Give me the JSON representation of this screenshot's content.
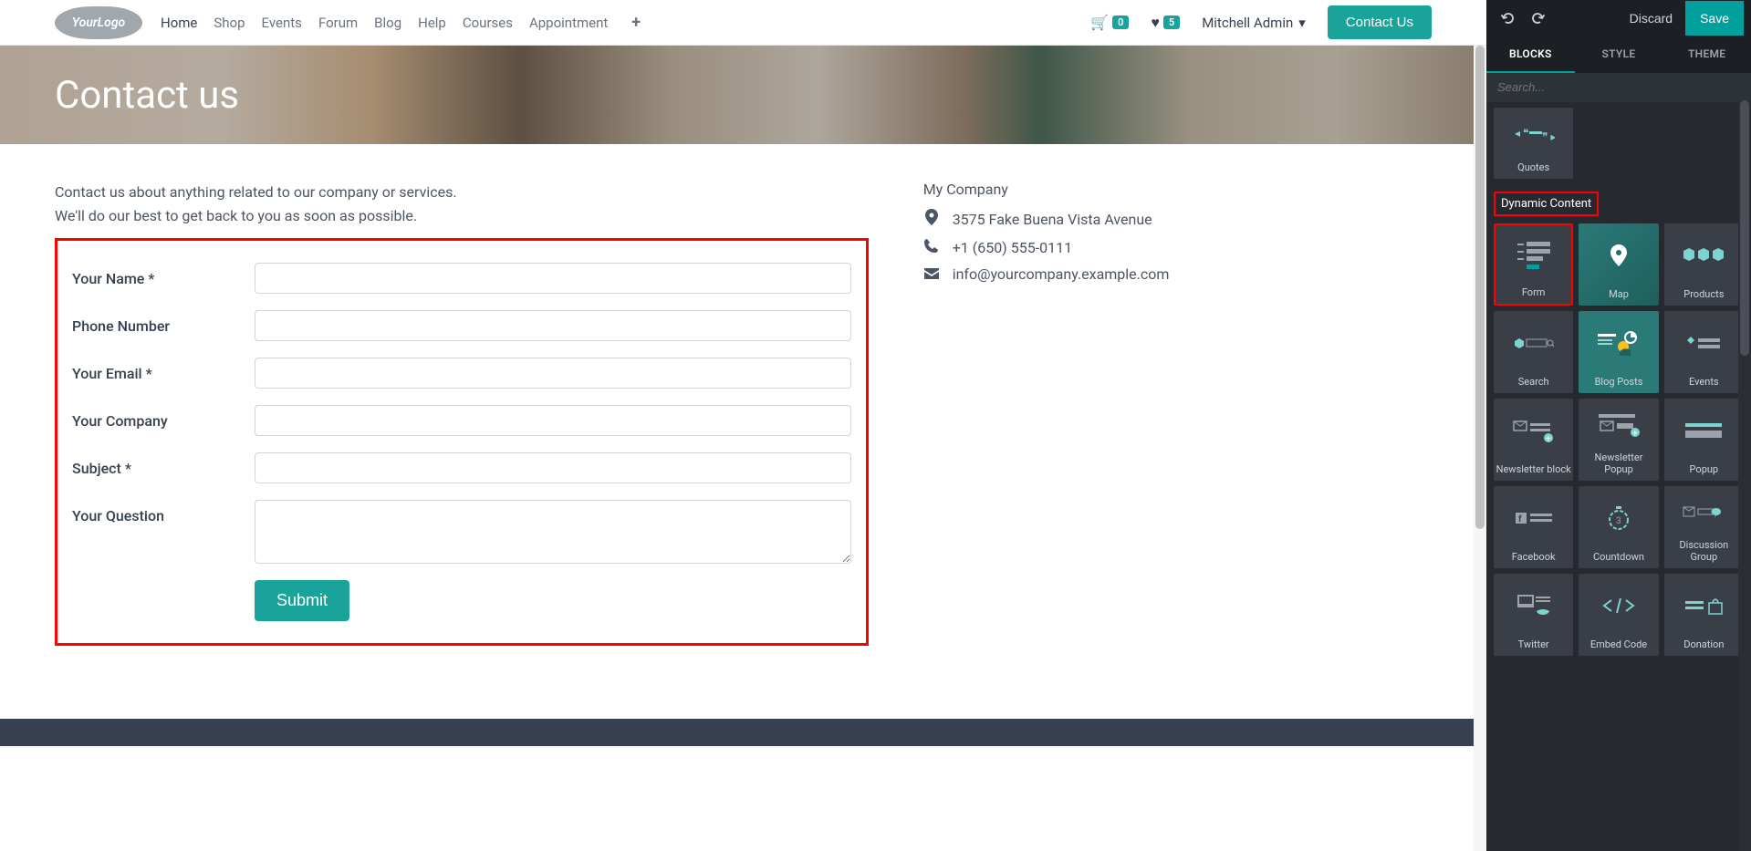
{
  "nav": {
    "logo": "YourLogo",
    "links": [
      "Home",
      "Shop",
      "Events",
      "Forum",
      "Blog",
      "Help",
      "Courses",
      "Appointment"
    ],
    "cart_count": "0",
    "wishlist_count": "5",
    "user": "Mitchell Admin",
    "contact_btn": "Contact Us"
  },
  "hero": {
    "title": "Contact us"
  },
  "intro": {
    "line1": "Contact us about anything related to our company or services.",
    "line2": "We'll do our best to get back to you as soon as possible."
  },
  "form": {
    "name_label": "Your Name",
    "phone_label": "Phone Number",
    "email_label": "Your Email",
    "company_label": "Your Company",
    "subject_label": "Subject",
    "question_label": "Your Question",
    "required_mark": "*",
    "submit": "Submit"
  },
  "company": {
    "name": "My Company",
    "address": "3575 Fake Buena Vista Avenue",
    "phone": "+1 (650) 555-0111",
    "email": "info@yourcompany.example.com"
  },
  "panel": {
    "discard": "Discard",
    "save": "Save",
    "tabs": {
      "blocks": "BLOCKS",
      "style": "STYLE",
      "theme": "THEME"
    },
    "search_placeholder": "Search...",
    "quotes_label": "Quotes",
    "dynamic_title": "Dynamic Content",
    "blocks": {
      "form": "Form",
      "map": "Map",
      "products": "Products",
      "search": "Search",
      "blog_posts": "Blog Posts",
      "events": "Events",
      "newsletter_block": "Newsletter block",
      "newsletter_popup": "Newsletter Popup",
      "popup": "Popup",
      "facebook": "Facebook",
      "countdown": "Countdown",
      "discussion_group": "Discussion Group",
      "twitter": "Twitter",
      "embed_code": "Embed Code",
      "donation": "Donation"
    }
  }
}
